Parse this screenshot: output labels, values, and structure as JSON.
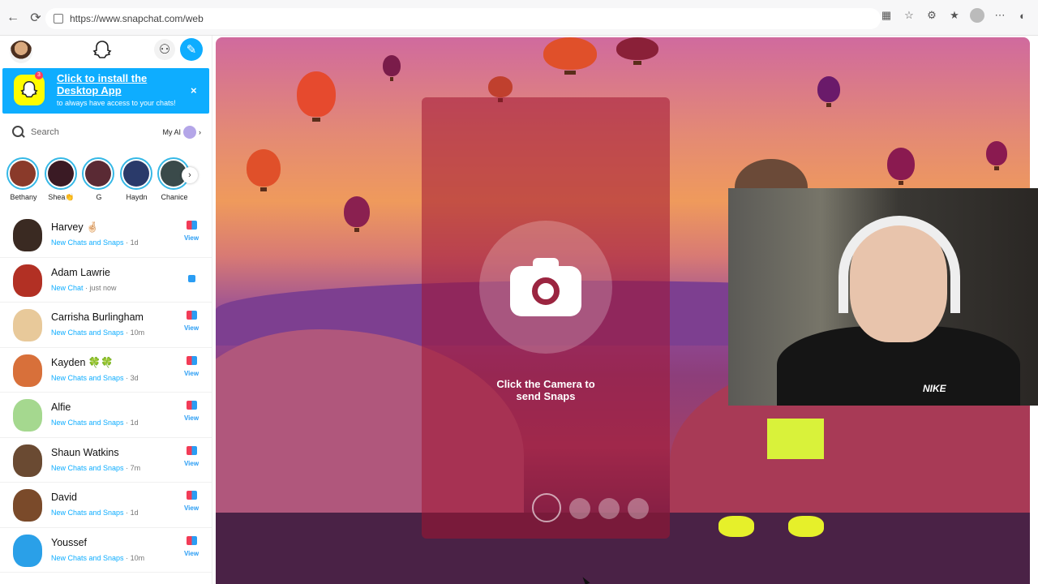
{
  "browser": {
    "url": "https://www.snapchat.com/web",
    "back_icon": "arrow-left-icon",
    "reload_icon": "reload-icon"
  },
  "sidebar": {
    "install_banner": {
      "title": "Click to install the Desktop App",
      "subtitle": "to always have access to your chats!",
      "close": "×",
      "badge_count": "3"
    },
    "search": {
      "placeholder": "Search",
      "my_ai_label": "My AI",
      "chevron": "›"
    },
    "stories": [
      {
        "name": "Bethany",
        "color": "#8a3a2a"
      },
      {
        "name": "Shea👏",
        "color": "#3a1a24"
      },
      {
        "name": "G",
        "color": "#5a2a34"
      },
      {
        "name": "Haydn",
        "color": "#2a3a6a"
      },
      {
        "name": "Chanice",
        "color": "#3a4a4a"
      }
    ],
    "stories_next": "›",
    "chats": [
      {
        "name": "Harvey 🤞🏻",
        "status": "New Chats and Snaps",
        "time": "· 1d",
        "action": "View",
        "avatar": "#3a2a22",
        "kind": "both"
      },
      {
        "name": "Adam Lawrie",
        "status": "New Chat",
        "time": "· just now",
        "action": "",
        "avatar": "#b23024",
        "kind": "chat"
      },
      {
        "name": "Carrisha Burlingham",
        "status": "New Chats and Snaps",
        "time": "· 10m",
        "action": "View",
        "avatar": "#e8c99a",
        "kind": "both"
      },
      {
        "name": "Kayden 🍀🍀",
        "status": "New Chats and Snaps",
        "time": "· 3d",
        "action": "View",
        "avatar": "#d8703a",
        "kind": "both"
      },
      {
        "name": "Alfie",
        "status": "New Chats and Snaps",
        "time": "· 1d",
        "action": "View",
        "avatar": "#a5d88f",
        "kind": "both"
      },
      {
        "name": "Shaun Watkins",
        "status": "New Chats and Snaps",
        "time": "· 7m",
        "action": "View",
        "avatar": "#6a4a32",
        "kind": "both"
      },
      {
        "name": "David",
        "status": "New Chats and Snaps",
        "time": "· 1d",
        "action": "View",
        "avatar": "#7a4a2a",
        "kind": "both"
      },
      {
        "name": "Youssef",
        "status": "New Chats and Snaps",
        "time": "· 10m",
        "action": "View",
        "avatar": "#2aa0e8",
        "kind": "both"
      }
    ]
  },
  "camera": {
    "prompt_line1": "Click the Camera to",
    "prompt_line2": "send Snaps"
  },
  "webcam": {
    "shirt_logo": "NIKE"
  }
}
